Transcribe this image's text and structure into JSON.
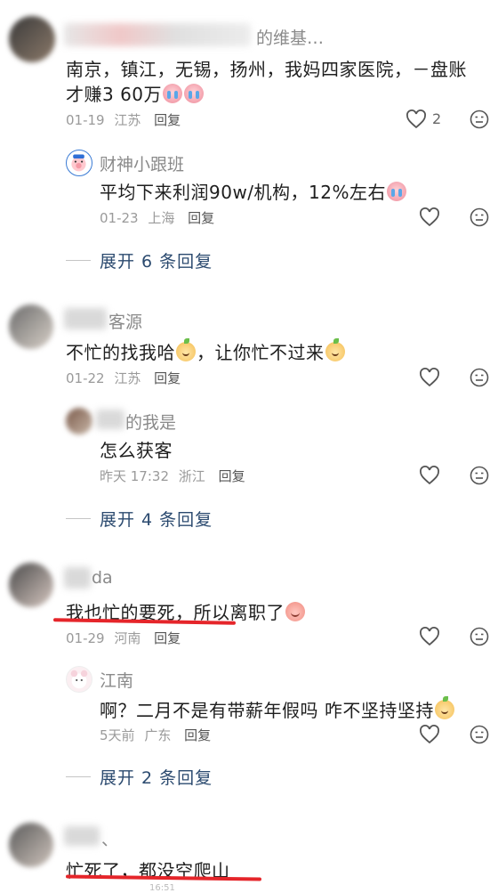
{
  "comments": [
    {
      "name_suffix": "的维基…",
      "text_line1": "南京，镇江，无锡，扬州，我妈四家医院，－盘账",
      "text_line2": "才赚3 60万",
      "date": "01-19",
      "location": "江苏",
      "reply_label": "回复",
      "like_count": "2",
      "replies": [
        {
          "name": "财神小跟班",
          "text": "平均下来利润90w/机构，12%左右",
          "date": "01-23",
          "location": "上海",
          "reply_label": "回复"
        }
      ],
      "expand_label": "展开 6 条回复"
    },
    {
      "name_suffix": "客源",
      "text": "不忙的找我哈",
      "text_after": "，让你忙不过来",
      "date": "01-22",
      "location": "江苏",
      "reply_label": "回复",
      "replies": [
        {
          "name_suffix": "的我是",
          "text": "怎么获客",
          "date": "昨天 17:32",
          "location": "浙江",
          "reply_label": "回复"
        }
      ],
      "expand_label": "展开 4 条回复"
    },
    {
      "name_suffix": "da",
      "text": "我也忙的要死，所以离职了",
      "date": "01-29",
      "location": "河南",
      "reply_label": "回复",
      "replies": [
        {
          "name": "江南",
          "text": "啊？二月不是有带薪年假吗 咋不坚持坚持",
          "date": "5天前",
          "location": "广东",
          "reply_label": "回复"
        }
      ],
      "expand_label": "展开 2 条回复"
    },
    {
      "name_suffix": "、",
      "text": "忙死了，都没空爬山",
      "footer_time": "16:51"
    }
  ],
  "colors": {
    "highlight_underline": "#e5252a",
    "expand_text": "#2b4a6f"
  }
}
